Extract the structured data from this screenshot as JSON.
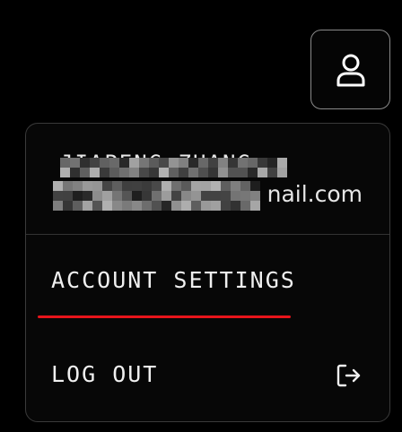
{
  "header": {
    "avatar_icon": "user-icon"
  },
  "menu": {
    "user": {
      "name": "JIAPENG ZHANG",
      "email_suffix": "nail.com"
    },
    "items": [
      {
        "label": "ACCOUNT SETTINGS",
        "icon": null
      },
      {
        "label": "LOG OUT",
        "icon": "logout-icon"
      }
    ]
  },
  "colors": {
    "background": "#000000",
    "accent_underline": "#e8141b",
    "text": "#f0f0f0"
  }
}
